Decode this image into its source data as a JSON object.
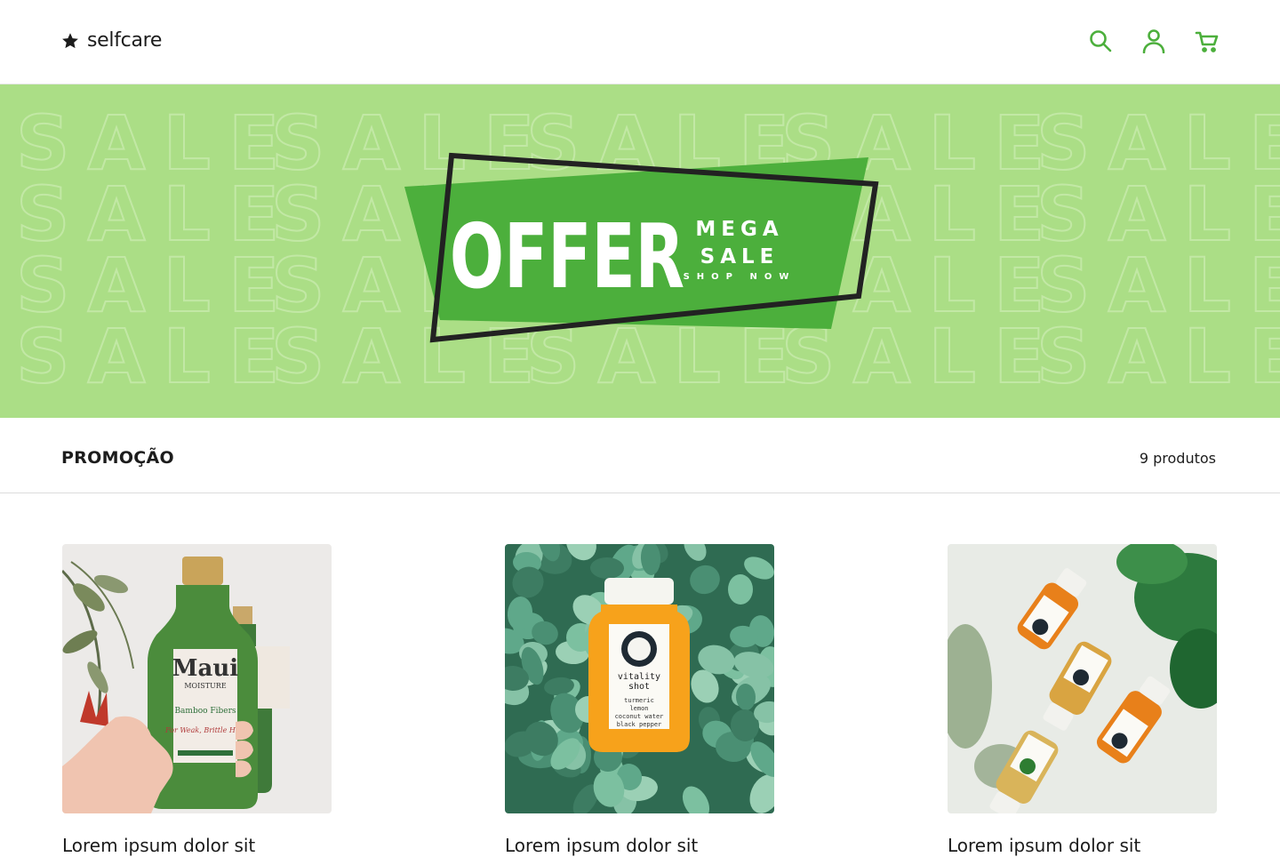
{
  "brand": {
    "name": "selfcare",
    "icon": "star-icon"
  },
  "header": {
    "icons": [
      "search-icon",
      "user-icon",
      "cart-icon"
    ],
    "icon_color": "#4caf3c"
  },
  "banner": {
    "background_word": "SALE",
    "background_color": "#abde86",
    "badge_color": "#4caf3c",
    "offer": "OFFER",
    "line1": "MEGA",
    "line2": "SALE",
    "cta": "SHOP NOW"
  },
  "section": {
    "title": "PROMOÇÃO",
    "count": "9 produtos"
  },
  "products": [
    {
      "name": "Lorem ipsum dolor sit",
      "image": "green shampoo bottle held in hand with flowers"
    },
    {
      "name": "Lorem ipsum dolor sit",
      "image": "orange juice bottle on eucalyptus leaves"
    },
    {
      "name": "Lorem ipsum dolor sit",
      "image": "four juice shot bottles with green plant"
    }
  ]
}
